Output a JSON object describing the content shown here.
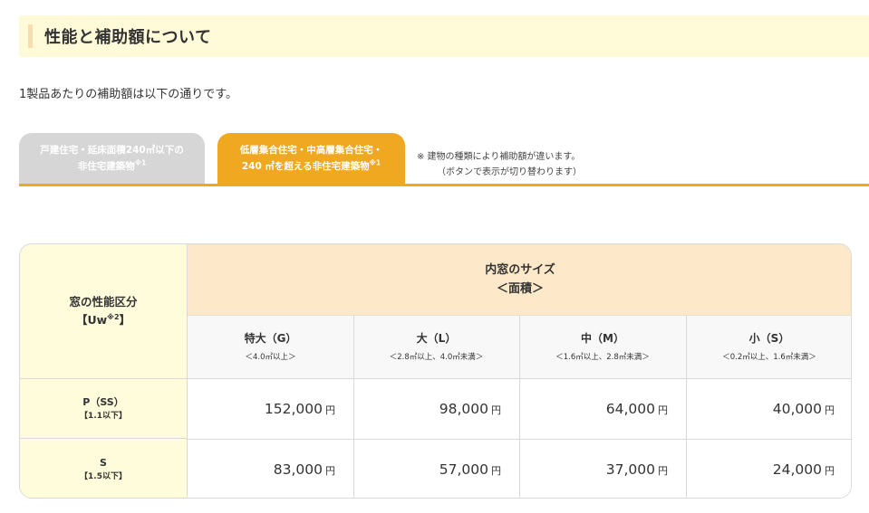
{
  "section": {
    "title": "性能と補助額について"
  },
  "intro": "1製品あたりの補助額は以下の通りです。",
  "tabs": [
    {
      "line1": "戸建住宅・延床面積240㎡以下の",
      "line2": "非住宅建築物",
      "sup": "※1",
      "active": false
    },
    {
      "line1": "低層集合住宅・中高層集合住宅・",
      "line2": "240 ㎡を超える非住宅建築物",
      "sup": "※1",
      "active": true
    }
  ],
  "tab_note": {
    "line1": "※  建物の種類により補助額が違います。",
    "line2": "（ボタンで表示が切り替わります）"
  },
  "table": {
    "row_header": {
      "line1": "窓の性能区分",
      "line2_prefix": "【Uw",
      "line2_sup": "※2",
      "line2_suffix": "】"
    },
    "size_header": {
      "line1": "内窓のサイズ",
      "line2": "＜面積＞"
    },
    "columns": [
      {
        "name": "特大（G）",
        "range": "＜4.0㎡以上＞"
      },
      {
        "name": "大（L）",
        "range": "＜2.8㎡以上、4.0㎡未満＞"
      },
      {
        "name": "中（M）",
        "range": "＜1.6㎡以上、2.8㎡未満＞"
      },
      {
        "name": "小（S）",
        "range": "＜0.2㎡以上、1.6㎡未満＞"
      }
    ],
    "rows": [
      {
        "grade": "P（SS）",
        "uw": "【1.1以下】",
        "amounts": [
          "152,000",
          "98,000",
          "64,000",
          "40,000"
        ]
      },
      {
        "grade": "S",
        "uw": "【1.5以下】",
        "amounts": [
          "83,000",
          "57,000",
          "37,000",
          "24,000"
        ]
      }
    ],
    "unit": "円"
  },
  "colors": {
    "accent": "#efa81f",
    "tab_inactive": "#d6d6d6",
    "header_bg": "#fde9c9",
    "row_header_bg": "#fffcdc",
    "section_bg": "#fffbd9"
  }
}
